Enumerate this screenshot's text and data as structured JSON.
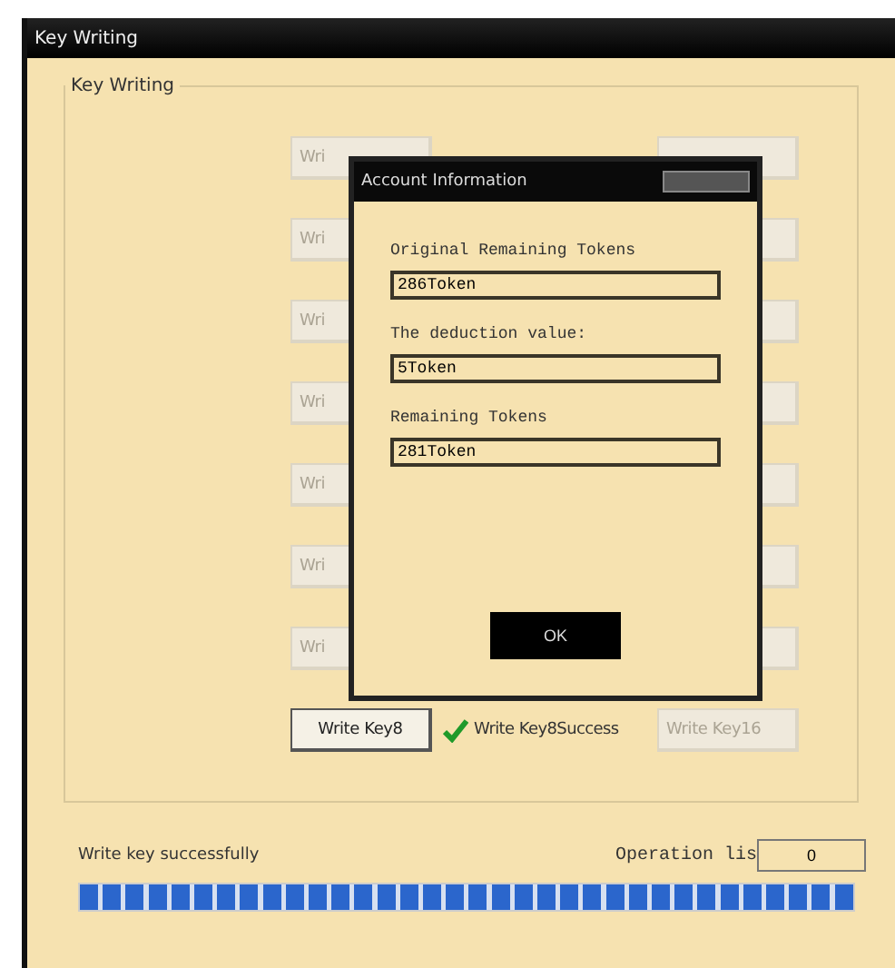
{
  "window": {
    "title": "Key Writing"
  },
  "group": {
    "title": "Key Writing"
  },
  "rows": [
    {
      "left": {
        "label": "Wri",
        "disabled": true
      },
      "right": {
        "disabled": true
      }
    },
    {
      "left": {
        "label": "Wri",
        "disabled": true
      },
      "right": {
        "disabled": true
      }
    },
    {
      "left": {
        "label": "Wri",
        "disabled": true
      },
      "right": {
        "disabled": true
      }
    },
    {
      "left": {
        "label": "Wri",
        "disabled": true
      },
      "right": {
        "disabled": true
      }
    },
    {
      "left": {
        "label": "Wri",
        "disabled": true
      },
      "right": {
        "disabled": true
      }
    },
    {
      "left": {
        "label": "Wri",
        "disabled": true
      },
      "right": {
        "disabled": true
      }
    },
    {
      "left": {
        "label": "Wri",
        "disabled": true
      },
      "right": {
        "disabled": true
      }
    },
    {
      "left": {
        "label": "Write Key8",
        "disabled": false
      },
      "result": {
        "text": "Write Key8Success",
        "success": true
      },
      "right": {
        "label": "Write Key16",
        "disabled": true
      }
    }
  ],
  "dialog": {
    "title": "Account Information",
    "fields": [
      {
        "label": "Original Remaining Tokens",
        "value": "286Token"
      },
      {
        "label": "The deduction value:",
        "value": "5Token"
      },
      {
        "label": "Remaining Tokens",
        "value": "281Token"
      }
    ],
    "button": "OK"
  },
  "status": {
    "text": "Write key successfully",
    "operation_label": "Operation lis",
    "operation_value": "0"
  },
  "progress": {
    "level": 1
  }
}
